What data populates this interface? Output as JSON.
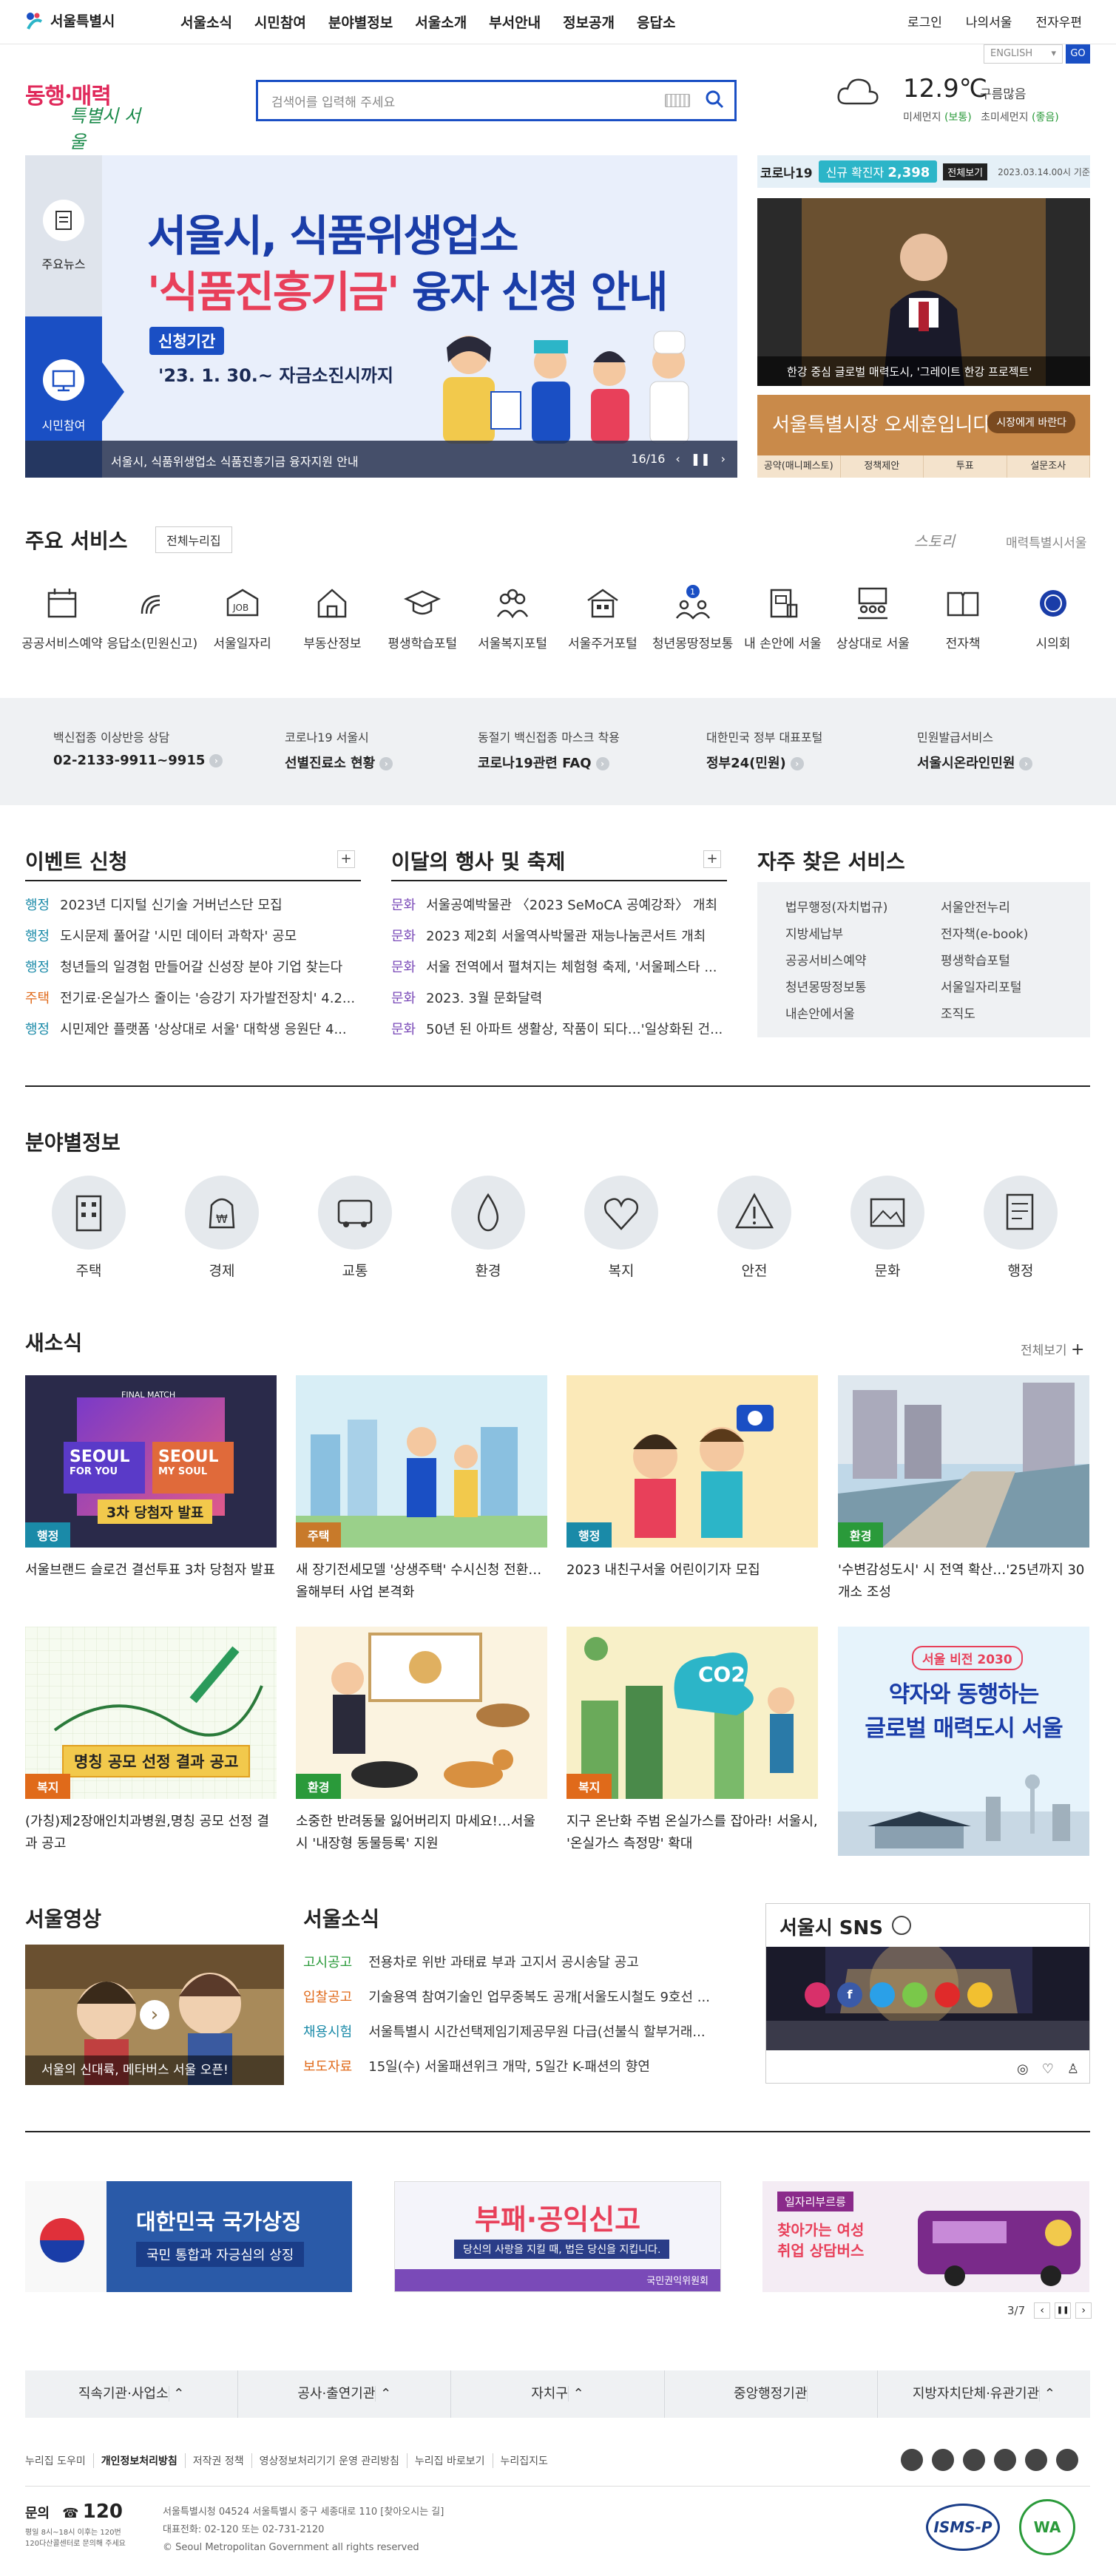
{
  "gnb": {
    "logo": "서울특별시",
    "menu": [
      "서울소식",
      "시민참여",
      "분야별정보",
      "서울소개",
      "부서안내",
      "정보공개",
      "응답소"
    ],
    "util": [
      "로그인",
      "나의서울",
      "전자우편"
    ]
  },
  "header": {
    "slogan_1": "동행·매력",
    "slogan_2": "특별시 서울",
    "search_placeholder": "검색어를 입력해 주세요",
    "lang": "ENGLISH",
    "go": "GO",
    "temperature": "12.9℃",
    "sky": "구름많음",
    "dust_label_1": "미세먼지",
    "dust_value_1": "(보통)",
    "dust_label_2": "초미세먼지",
    "dust_value_2": "(좋음)"
  },
  "hero": {
    "side_top": "주요뉴스",
    "side_bottom": "시민참여",
    "title_1": "서울시, 식품위생업소",
    "title_2a": "'식품진흥기금'",
    "title_2b": " 융자 신청 안내",
    "period_label": "신청기간",
    "period": "'23. 1. 30.~ 자금소진시까지",
    "caption": "서울시, 식품위생업소 식품진흥기금 융자지원 안내",
    "counter": "16/16"
  },
  "corona": {
    "label": "코로나19",
    "new_label": "신규 확진자",
    "new_count": "2,398",
    "all_btn": "전체보기",
    "date": "2023.03.14.00시 기준"
  },
  "mayor": {
    "caption": "한강 중심 글로벌 매력도시, '그레이트 한강 프로젝트'"
  },
  "voice": {
    "title": "서울특별시장 오세훈입니다.",
    "button": "시장에게 바란다",
    "tabs": [
      "공약(매니페스토)",
      "정책제안",
      "투표",
      "설문조사"
    ]
  },
  "services": {
    "title": "주요 서비스",
    "all_btn": "전체누리집",
    "logo_1": "스토리",
    "logo_2": "매력특별시서울",
    "items": [
      "공공서비스예약",
      "응답소(민원신고)",
      "서울일자리",
      "부동산정보",
      "평생학습포털",
      "서울복지포털",
      "서울주거포털",
      "청년몽땅정보통",
      "내 손안에 서울",
      "상상대로 서울",
      "전자책",
      "시의회"
    ],
    "badge": "1"
  },
  "quick": [
    {
      "s": "백신접종 이상반응 상담",
      "b": "02-2133-9911~9915"
    },
    {
      "s": "코로나19 서울시",
      "b": "선별진료소 현황"
    },
    {
      "s": "동절기 백신접종 마스크 착용",
      "b": "코로나19관련 FAQ"
    },
    {
      "s": "대한민국 정부 대표포털",
      "b": "정부24(민원)"
    },
    {
      "s": "민원발급서비스",
      "b": "서울시온라인민원"
    }
  ],
  "events": {
    "title": "이벤트 신청",
    "rows": [
      {
        "c": "행정",
        "t": "2023년 디지털 신기술 거버넌스단 모집"
      },
      {
        "c": "행정",
        "t": "도시문제 풀어갈 '시민 데이터 과학자' 공모"
      },
      {
        "c": "행정",
        "t": "청년들의 일경험 만들어갈 신성장 분야 기업 찾는다"
      },
      {
        "c": "주택",
        "t": "전기료·온실가스 줄이는 '승강기 자가발전장치' 4.2..."
      },
      {
        "c": "행정",
        "t": "시민제안 플랫폼 '상상대로 서울' 대학생 응원단 4..."
      }
    ]
  },
  "festival": {
    "title": "이달의 행사 및 축제",
    "rows": [
      {
        "c": "문화",
        "t": "서울공예박물관 〈2023 SeMoCA 공예강좌〉 개최"
      },
      {
        "c": "문화",
        "t": "2023 제2회 서울역사박물관 재능나눔콘서트 개최"
      },
      {
        "c": "문화",
        "t": "서울 전역에서 펼쳐지는 체험형 축제, '서울페스타 ..."
      },
      {
        "c": "문화",
        "t": "2023. 3월 문화달력"
      },
      {
        "c": "문화",
        "t": "50년 된 아파트 생활상, 작품이 되다…'일상화된 건..."
      }
    ]
  },
  "frequent": {
    "title": "자주 찾은 서비스",
    "col1": [
      "법무행정(자치법규)",
      "지방세납부",
      "공공서비스예약",
      "청년몽땅정보통",
      "내손안에서울"
    ],
    "col2": [
      "서울안전누리",
      "전자책(e-book)",
      "평생학습포털",
      "서울일자리포털",
      "조직도"
    ]
  },
  "field": {
    "title": "분야별정보",
    "items": [
      "주택",
      "경제",
      "교통",
      "환경",
      "복지",
      "안전",
      "문화",
      "행정"
    ]
  },
  "news": {
    "title": "새소식",
    "all": "전체보기",
    "items": [
      {
        "tag": "행정",
        "t": "서울브랜드 슬로건 결선투표 3차 당첨자 발표",
        "img_1": "SEOUL",
        "img_2": "FOR YOU",
        "img_3": "SEOUL",
        "img_4": "MY SOUL",
        "img_5": "3차 당첨자 발표",
        "img_6": "FINAL MATCH"
      },
      {
        "tag": "주택",
        "t": "새 장기전세모델 '상생주택' 수시신청 전환…올해부터 사업 본격화"
      },
      {
        "tag": "행정",
        "t": "2023 내친구서울 어린이기자 모집"
      },
      {
        "tag": "환경",
        "t": "'수변감성도시' 시 전역 확산…'25년까지 30개소 조성"
      },
      {
        "tag": "복지",
        "t": "(가칭)제2장애인치과병원,명칭 공모 선정 결과 공고",
        "img": "명칭 공모 선정 결과 공고"
      },
      {
        "tag": "환경",
        "t": "소중한 반려동물 잃어버리지 마세요!…서울시 '내장형 동물등록' 지원"
      },
      {
        "tag": "복지",
        "t": "지구 온난화 주범 온실가스를 잡아라! 서울시, '온실가스 측정망' 확대",
        "img": "CO2"
      },
      {
        "tag": "",
        "t": "",
        "img_1": "서울 비전 2030",
        "img_2": "약자와 동행하는",
        "img_3": "글로벌 매력도시 서울"
      }
    ]
  },
  "video": {
    "title": "서울영상",
    "caption": "서울의 신대륙, 메타버스 서울 오픈!"
  },
  "seoulnews": {
    "title": "서울소식",
    "rows": [
      {
        "c": "고시공고",
        "t": "전용차로 위반 과태료 부과 고지서 공시송달 공고",
        "color": "#2a9a3a"
      },
      {
        "c": "입찰공고",
        "t": "기술용역 참여기술인 업무중복도 공개[서울도시철도 9호선 ..."
      },
      {
        "c": "채용시험",
        "t": "서울특별시 시간선택제임기제공무원 다급(선불식 할부거래..."
      },
      {
        "c": "보도자료",
        "t": "15일(수) 서울패션위크 개막, 5일간 K-패션의 향연"
      }
    ]
  },
  "sns": {
    "title": "서울시 SNS"
  },
  "banners": {
    "b1_t": "대한민국 국가상징",
    "b1_s": "국민 통합과 자긍심의 상징",
    "b2_t": "부패·공익신고",
    "b2_s": "당신의 사랑을 지킬 때, 법은 당신을 지킵니다.",
    "b2_org": "국민권익위원회",
    "b3_tag": "일자리부르릉",
    "b3_t1": "찾아가는 여성",
    "b3_t2": "취업 상담버스",
    "counter": "3/7"
  },
  "footer": {
    "tabs": [
      "직속기관·사업소",
      "공사·출연기관",
      "자치구",
      "중앙행정기관",
      "지방자치단체·유관기관"
    ],
    "links": [
      "누리집 도우미",
      "개인정보처리방침",
      "저작권 정책",
      "영상정보처리기기 운영 관리방침",
      "누리집 바로보기",
      "누리집지도"
    ],
    "call_label": "문의",
    "call_num": "120",
    "call_sub_1": "평일 8시~18시 이후는 120번",
    "call_sub_2": "120다산콜센터로 문의해 주세요",
    "addr": "서울특별시청 04524 서울특별시 중구 세종대로 110 [찾아오시는 길]",
    "tel": "대표전화: 02-120 또는 02-731-2120",
    "copy": "© Seoul Metropolitan Government all rights reserved",
    "cert_1": "ISMS-P",
    "cert_2": "WA"
  },
  "colors": {
    "primary": "#1a4fc4",
    "accent": "#e8405a",
    "teal": "#2cb5c8"
  }
}
